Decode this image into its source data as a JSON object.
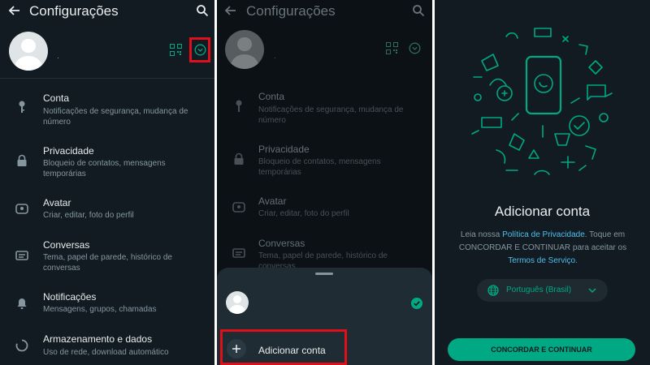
{
  "settings": {
    "title": "Configurações",
    "profile_name": ".",
    "items": [
      {
        "title": "Conta",
        "subtitle": "Notificações de segurança, mudança de número",
        "icon": "key-icon"
      },
      {
        "title": "Privacidade",
        "subtitle": "Bloqueio de contatos, mensagens temporárias",
        "icon": "lock-icon"
      },
      {
        "title": "Avatar",
        "subtitle": "Criar, editar, foto do perfil",
        "icon": "avatar-icon"
      },
      {
        "title": "Conversas",
        "subtitle": "Tema, papel de parede, histórico de conversas",
        "icon": "chat-icon"
      },
      {
        "title": "Notificações",
        "subtitle": "Mensagens, grupos, chamadas",
        "icon": "bell-icon"
      },
      {
        "title": "Armazenamento e dados",
        "subtitle": "Uso de rede, download automático",
        "icon": "storage-icon"
      }
    ]
  },
  "account_sheet": {
    "add_account_label": "Adicionar conta"
  },
  "add_account_screen": {
    "title": "Adicionar conta",
    "text_before": "Leia nossa ",
    "privacy_link": "Política de Privacidade",
    "text_middle": ". Toque em CONCORDAR E CONTINUAR para aceitar os ",
    "terms_link": "Termos de Serviço",
    "text_after": ".",
    "language": "Português (Brasil)",
    "agree_button": "CONCORDAR E CONTINUAR"
  },
  "colors": {
    "accent": "#00a884",
    "background": "#111b21",
    "highlight_border": "#e0101b",
    "link": "#53bdeb"
  }
}
